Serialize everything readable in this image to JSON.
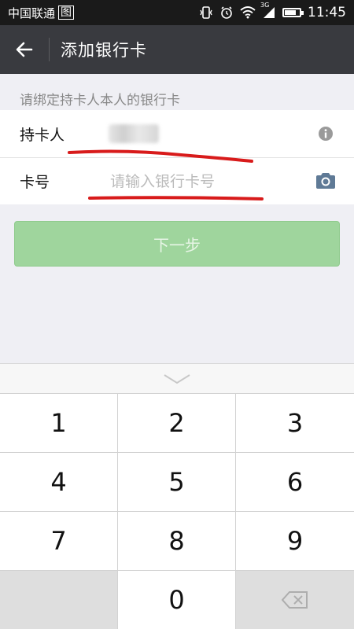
{
  "status_bar": {
    "carrier": "中国联通",
    "carrier_badge": "图",
    "network": "3G",
    "time": "11:45"
  },
  "header": {
    "title": "添加银行卡",
    "back_icon": "arrow-left-icon"
  },
  "hint": "请绑定持卡人本人的银行卡",
  "form": {
    "cardholder_label": "持卡人",
    "cardholder_info_icon": "info-icon",
    "card_number_label": "卡号",
    "card_number_value": "",
    "card_number_placeholder": "请输入银行卡号",
    "camera_icon": "camera-icon"
  },
  "next_button": "下一步",
  "keyboard": {
    "collapse_icon": "chevron-down-icon",
    "keys": [
      "1",
      "2",
      "3",
      "4",
      "5",
      "6",
      "7",
      "8",
      "9",
      "",
      "0",
      ""
    ],
    "backspace_icon": "backspace-icon"
  },
  "colors": {
    "title_bar": "#393a3f",
    "next_button": "#9fd59d",
    "annotation": "#d81b1b"
  }
}
